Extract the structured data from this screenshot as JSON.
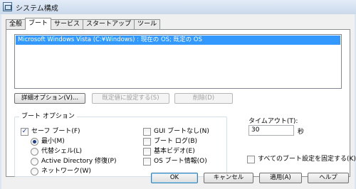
{
  "window": {
    "title": "システム構成"
  },
  "tabs": [
    {
      "label": "全般"
    },
    {
      "label": "ブート"
    },
    {
      "label": "サービス"
    },
    {
      "label": "スタートアップ"
    },
    {
      "label": "ツール"
    }
  ],
  "boot": {
    "entries": [
      "Microsoft Windows Vista (C:¥Windows) : 現在の OS; 既定の OS"
    ],
    "selected_entry": 0,
    "buttons": {
      "advanced": "詳細オプション(V)...",
      "set_default": "既定値に設定する(S)",
      "delete": "削除(D)"
    },
    "options": {
      "legend": "ブート オプション",
      "safe_boot": {
        "label": "セーフ ブート(F)",
        "checked": true
      },
      "minimal": {
        "label": "最小(M)",
        "selected": true
      },
      "alternate_shell": {
        "label": "代替シェル(L)",
        "selected": false
      },
      "active_directory_repair": {
        "label": "Active Directory 修復(P)",
        "selected": false
      },
      "network": {
        "label": "ネットワーク(W)",
        "selected": false
      },
      "no_gui_boot": {
        "label": "GUI ブートなし(N)",
        "checked": false
      },
      "boot_log": {
        "label": "ブート ログ(B)",
        "checked": false
      },
      "base_video": {
        "label": "基本ビデオ(E)",
        "checked": false
      },
      "os_boot_info": {
        "label": "OS ブート情報(O)",
        "checked": false
      }
    },
    "timeout": {
      "label": "タイムアウト(T):",
      "value": "30",
      "unit": "秒"
    },
    "make_permanent": {
      "label": "すべてのブート設定を固定する(K)",
      "checked": false
    }
  },
  "dialog_buttons": {
    "ok": "OK",
    "cancel": "キャンセル",
    "apply": "適用(A)",
    "help": "ヘルプ"
  }
}
